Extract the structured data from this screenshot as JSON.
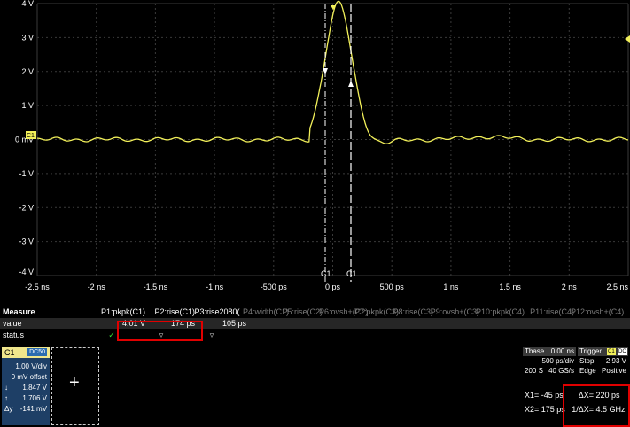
{
  "scope": {
    "y_labels": [
      "4 V",
      "3 V",
      "2 V",
      "1 V",
      "0 mV",
      "-1 V",
      "-2 V",
      "-3 V",
      "-4 V"
    ],
    "x_labels": [
      "-2.5 ns",
      "-2 ns",
      "-1.5 ns",
      "-1 ns",
      "-500 ps",
      "0 ps",
      "500 ps",
      "1 ns",
      "1.5 ns",
      "2 ns",
      "2.5 ns"
    ],
    "channel_marker": "C1",
    "cursor_labels": [
      "C1",
      "C1"
    ],
    "trace_color": "#f2f05a",
    "grid_color": "#3a3a3a"
  },
  "measure": {
    "header": "Measure",
    "row_value": "value",
    "row_status": "status",
    "params": [
      {
        "name": "P1:pkpk(C1)",
        "value": "4.01 V",
        "status": "✓",
        "active": true
      },
      {
        "name": "P2:rise(C1)",
        "value": "174 ps",
        "status": "▿",
        "active": true
      },
      {
        "name": "P3:rise2080(...",
        "value": "105 ps",
        "status": "▿",
        "active": true
      },
      {
        "name": "P4:width(C1)",
        "value": "",
        "status": "",
        "active": false
      },
      {
        "name": "P5:rise(C2)",
        "value": "",
        "status": "",
        "active": false
      },
      {
        "name": "P6:ovsh+(C2)",
        "value": "",
        "status": "",
        "active": false
      },
      {
        "name": "P7:pkpk(C3)",
        "value": "",
        "status": "",
        "active": false
      },
      {
        "name": "P8:rise(C3)",
        "value": "",
        "status": "",
        "active": false
      },
      {
        "name": "P9:ovsh+(C3)",
        "value": "",
        "status": "",
        "active": false
      },
      {
        "name": "P10:pkpk(C4)",
        "value": "",
        "status": "",
        "active": false
      },
      {
        "name": "P11:rise(C4)",
        "value": "",
        "status": "",
        "active": false
      },
      {
        "name": "P12:ovsh+(C4)",
        "value": "",
        "status": "",
        "active": false
      }
    ]
  },
  "channel": {
    "name": "C1",
    "coupling": "DC50",
    "vdiv": "1.00 V/div",
    "offset": "0 mV offset",
    "cursor1": "1.847 V",
    "cursor2": "1.706 V",
    "cursor1_marker": "↓",
    "cursor2_marker": "↑",
    "dy_label": "Δy",
    "dy": "-141 mV"
  },
  "timebase": {
    "label": "Tbase",
    "delay": "0.00 ns",
    "tdiv": "500 ps/div",
    "samples": "200 S",
    "rate": "40 GS/s"
  },
  "trigger": {
    "label": "Trigger",
    "source": "C1",
    "coupling": "DC",
    "mode": "Stop",
    "level": "2.93 V",
    "type": "Edge",
    "slope": "Positive"
  },
  "cursors": {
    "x1_label": "X1=",
    "x1": "-45 ps",
    "x2_label": "X2=",
    "x2": "175 ps",
    "dx_label": "ΔX=",
    "dx": "220 ps",
    "inv_label": "1/ΔX=",
    "inv": "4.5 GHz"
  }
}
